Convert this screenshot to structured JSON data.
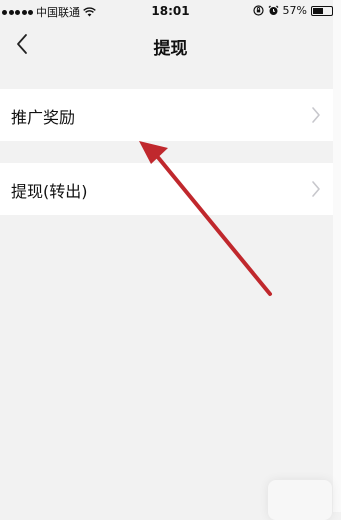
{
  "status_bar": {
    "carrier": "中国联通",
    "time": "18:01",
    "battery_percent_text": "57%",
    "battery_level": 0.57
  },
  "nav": {
    "title": "提现",
    "back_icon": "chevron-left-icon"
  },
  "list": {
    "items": [
      {
        "label": "推广奖励",
        "icon": "chevron-right-icon"
      },
      {
        "label": "提现(转出)",
        "icon": "chevron-right-icon"
      }
    ]
  },
  "annotation": {
    "arrow_color": "#c0282d"
  },
  "colors": {
    "background": "#f2f2f2",
    "row_background": "#ffffff",
    "chevron": "#c7c7cc",
    "text": "#111111"
  }
}
